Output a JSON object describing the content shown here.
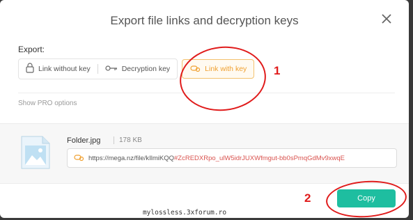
{
  "dialog": {
    "title": "Export file links and decryption keys",
    "close_icon": "close-icon"
  },
  "export": {
    "label": "Export:",
    "options": [
      {
        "label": "Link without key",
        "icon": "padlock-icon"
      },
      {
        "label": "Decryption key",
        "icon": "key-icon"
      },
      {
        "label": "Link with key",
        "icon": "link-key-icon",
        "active": true
      }
    ],
    "pro_link": "Show PRO options"
  },
  "file": {
    "name": "Folder.jpg",
    "size": "178 KB",
    "thumbnail_icon": "image-thumbnail-icon",
    "link_url": "https://mega.nz/file/kIlmiKQQ",
    "link_key": "#ZcREDXRpo_ulW5idrJUXWfmgut-bb0sPmqGdMv9xwqE"
  },
  "actions": {
    "copy_label": "Copy"
  },
  "annotations": {
    "number_1": "1",
    "number_2": "2"
  },
  "colors": {
    "accent_active": "#f0a030",
    "copy_button": "#1ebea0",
    "annotation_red": "#e01b1b",
    "key_text": "#d9534f"
  },
  "watermark": "mylossless.3xforum.ro"
}
